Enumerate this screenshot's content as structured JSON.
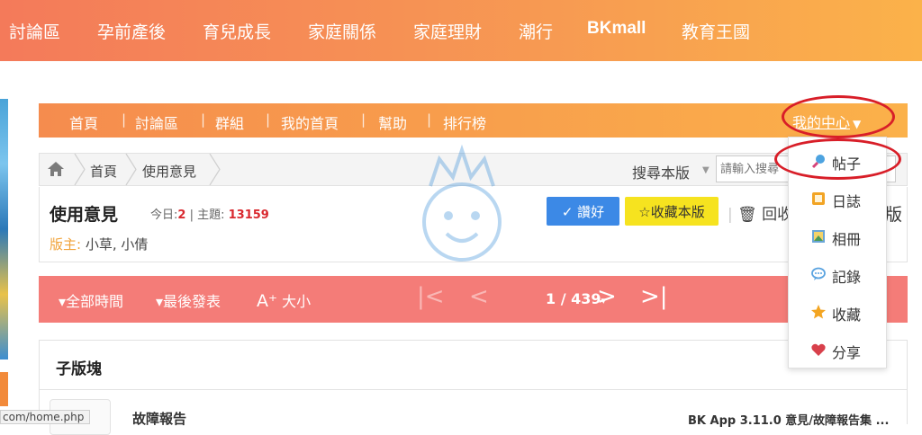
{
  "top_nav": {
    "items": [
      "討論區",
      "孕前產後",
      "育兒成長",
      "家庭關係",
      "家庭理財",
      "潮行",
      "BKmall",
      "教育王國"
    ]
  },
  "sub_nav": {
    "items": [
      "首頁",
      "討論區",
      "群組",
      "我的首頁",
      "幫助",
      "排行榜"
    ],
    "my_center": "我的中心"
  },
  "breadcrumb": {
    "items": [
      "首頁",
      "使用意見"
    ]
  },
  "search": {
    "label": "搜尋本版",
    "placeholder": "請輸入搜尋"
  },
  "forum": {
    "title": "使用意見",
    "today_label": "今日:",
    "today_count": "2",
    "topics_label": "主題:",
    "topics_count": "13159",
    "moderators_label": "版主:",
    "moderators": "小草, 小倩",
    "like_button": "讚好",
    "favorite_button": "收藏本版",
    "recycle": "回收",
    "ban_partial": "版"
  },
  "toolbar": {
    "time_filter": "全部時間",
    "sort": "最後發表",
    "font_size": "大小",
    "page_indicator": "1 / 439"
  },
  "subforum": {
    "heading": "子版塊",
    "row_title": "故障報告",
    "row_last_post": "BK App 3.11.0 意見/故障報告集 ..."
  },
  "status_url": "com/home.php",
  "dropdown": {
    "items": [
      {
        "label": "帖子",
        "icon": "post-icon"
      },
      {
        "label": "日誌",
        "icon": "diary-icon"
      },
      {
        "label": "相冊",
        "icon": "album-icon"
      },
      {
        "label": "記錄",
        "icon": "record-icon"
      },
      {
        "label": "收藏",
        "icon": "star-icon"
      },
      {
        "label": "分享",
        "icon": "share-icon"
      }
    ]
  },
  "colors": {
    "brand_orange": "#f79a52",
    "toolbar_red": "#f47c78",
    "like_blue": "#3c89e6",
    "favorite_yellow": "#f6e31f",
    "highlight_red": "#d81e28"
  }
}
